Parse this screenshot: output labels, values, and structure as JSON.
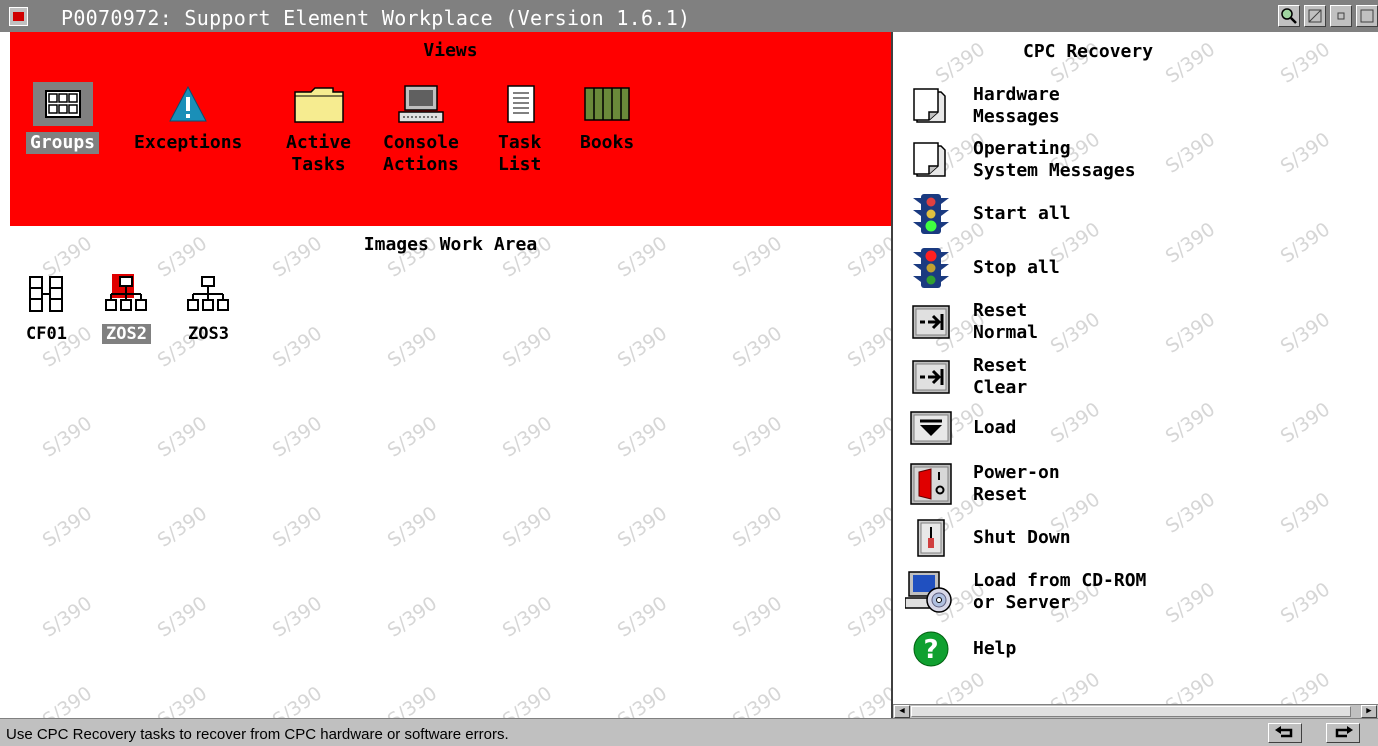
{
  "window": {
    "title": "P0070972: Support Element Workplace (Version 1.6.1)"
  },
  "views": {
    "title": "Views",
    "items": [
      {
        "label_line1": "Groups",
        "label_line2": "",
        "icon": "groups-icon",
        "selected": true
      },
      {
        "label_line1": "Exceptions",
        "label_line2": "",
        "icon": "exceptions-icon"
      },
      {
        "label_line1": "Active",
        "label_line2": "Tasks",
        "icon": "active-tasks-icon"
      },
      {
        "label_line1": "Console",
        "label_line2": "Actions",
        "icon": "console-actions-icon"
      },
      {
        "label_line1": "Task",
        "label_line2": "List",
        "icon": "task-list-icon"
      },
      {
        "label_line1": "Books",
        "label_line2": "",
        "icon": "books-icon"
      }
    ]
  },
  "work_area": {
    "title": "Images Work Area",
    "watermark": "S/390",
    "images": [
      {
        "label": "CF01",
        "icon": "coupling-facility-icon"
      },
      {
        "label": "ZOS2",
        "icon": "image-tree-icon",
        "selected": true
      },
      {
        "label": "ZOS3",
        "icon": "image-tree-icon"
      }
    ]
  },
  "recovery": {
    "title": "CPC Recovery",
    "tasks": [
      {
        "line1": "Hardware",
        "line2": "Messages",
        "icon": "hardware-messages-icon"
      },
      {
        "line1": "Operating",
        "line2": "System Messages",
        "icon": "os-messages-icon"
      },
      {
        "line1": "Start all",
        "line2": "",
        "icon": "traffic-light-green-icon"
      },
      {
        "line1": "Stop all",
        "line2": "",
        "icon": "traffic-light-red-icon"
      },
      {
        "line1": "Reset",
        "line2": "Normal",
        "icon": "reset-normal-icon"
      },
      {
        "line1": "Reset",
        "line2": "Clear",
        "icon": "reset-clear-icon"
      },
      {
        "line1": "Load",
        "line2": "",
        "icon": "load-icon"
      },
      {
        "line1": "Power-on",
        "line2": "Reset",
        "icon": "power-switch-icon"
      },
      {
        "line1": "Shut Down",
        "line2": "",
        "icon": "shutdown-switch-icon"
      },
      {
        "line1": "Load from CD-ROM",
        "line2": "or Server",
        "icon": "cd-rom-computer-icon"
      },
      {
        "line1": "Help",
        "line2": "",
        "icon": "help-icon"
      }
    ]
  },
  "status": {
    "message": "Use CPC Recovery tasks to recover from CPC hardware or software errors."
  },
  "colors": {
    "views_background": "#ff0000",
    "title_bar": "#808080",
    "selection": "#808080",
    "watermark": "#d6d6d6"
  }
}
